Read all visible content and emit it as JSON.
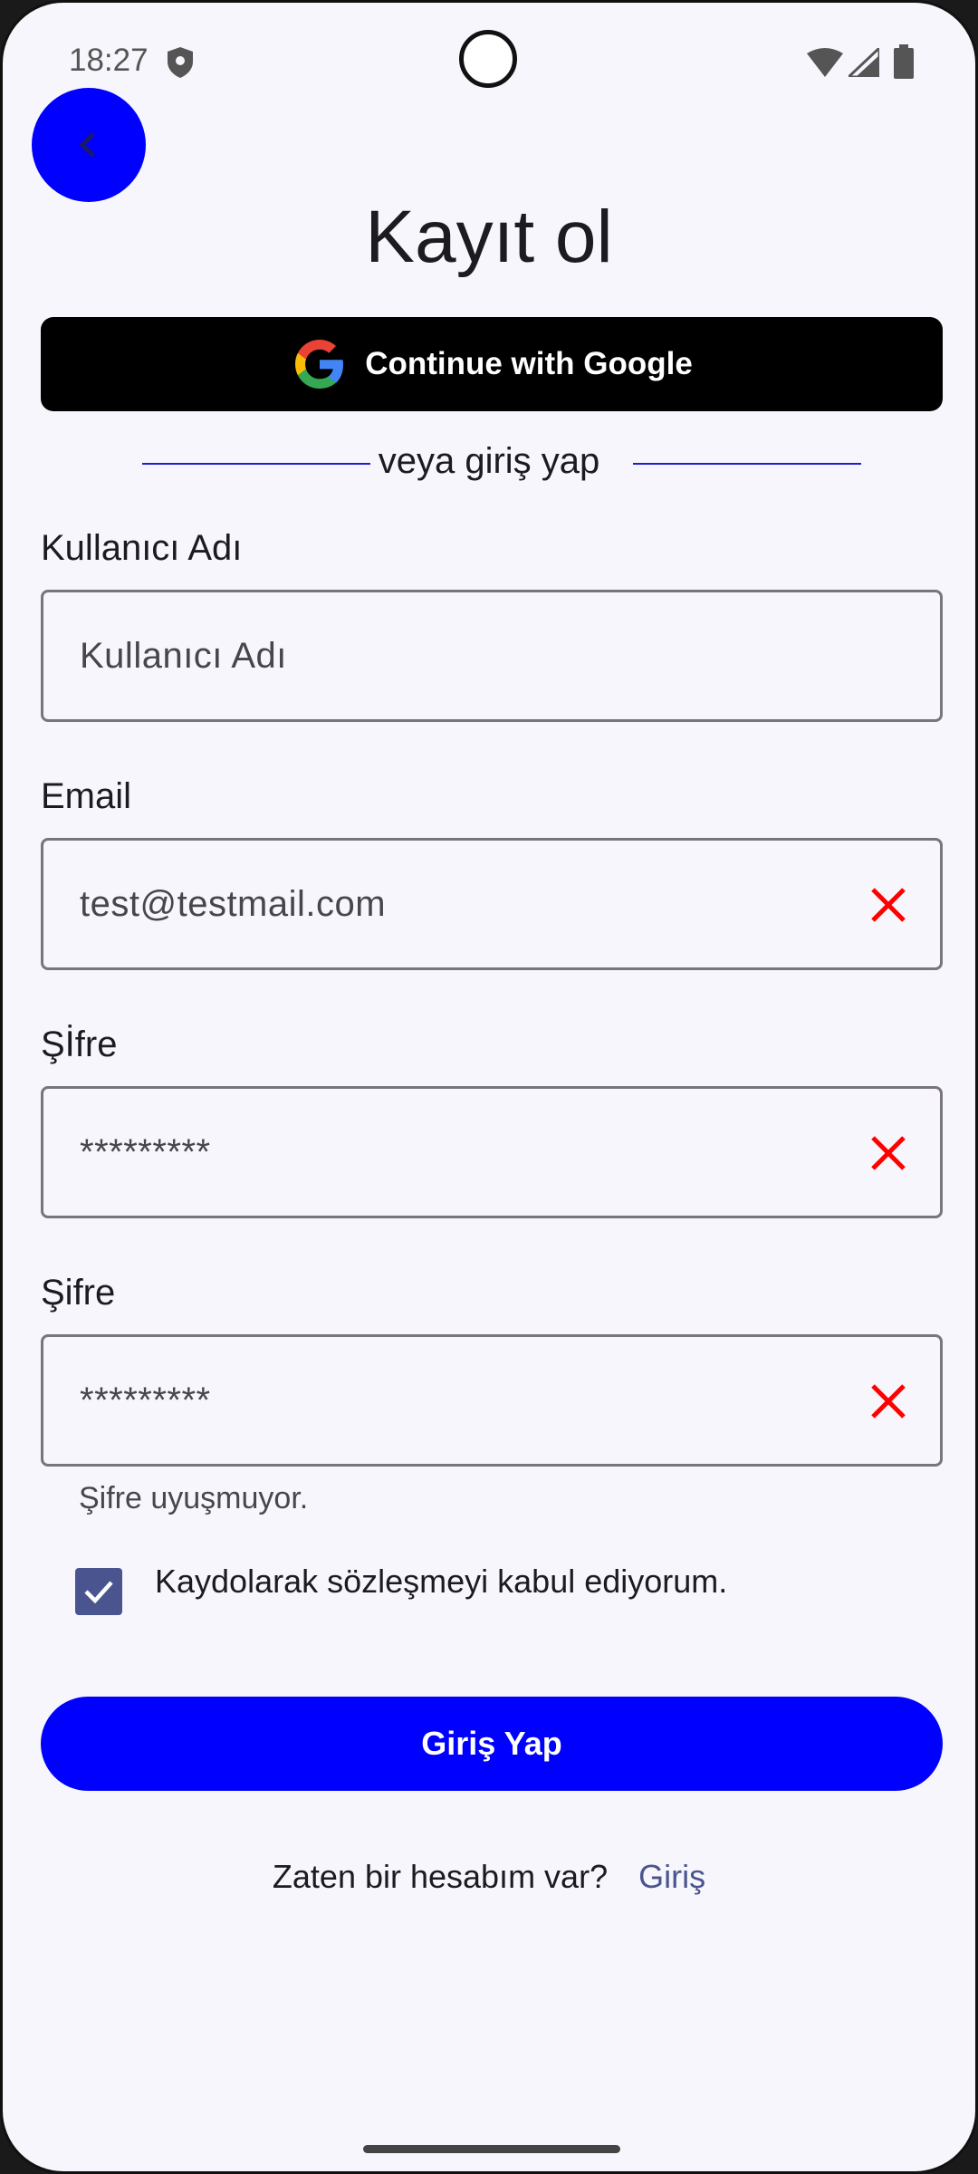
{
  "status_bar": {
    "time": "18:27",
    "icons": [
      "shield-icon",
      "wifi-icon",
      "signal-icon",
      "battery-icon"
    ]
  },
  "header": {
    "back_icon": "chevron-left-icon",
    "title": "Kayıt ol"
  },
  "google_button": {
    "label": "Continue with Google",
    "icon": "google-icon"
  },
  "divider": {
    "text": "veya giriş yap"
  },
  "fields": {
    "username": {
      "label": "Kullanıcı Adı",
      "placeholder": "Kullanıcı Adı"
    },
    "email": {
      "label": "Email",
      "value": "test@testmail.com"
    },
    "password": {
      "label": "Şİfre",
      "value": "*********"
    },
    "password_confirm": {
      "label": "Şifre",
      "value": "*********",
      "error": "Şifre uyuşmuyor."
    }
  },
  "agreement": {
    "checked": true,
    "label": "Kaydolarak sözleşmeyi kabul ediyorum."
  },
  "submit_button": {
    "label": "Giriş Yap"
  },
  "footer": {
    "text": "Zaten bir hesabım var?",
    "link": "Giriş"
  },
  "colors": {
    "accent": "#0000FF",
    "error": "#FF0000",
    "checkbox": "#4A5590",
    "background": "#F7F6FC"
  }
}
